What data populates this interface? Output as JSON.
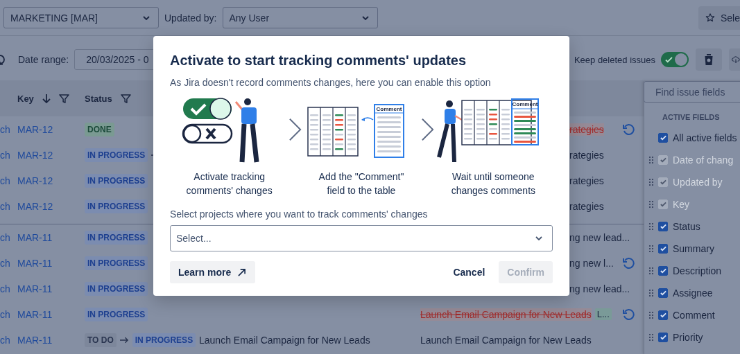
{
  "project_select": {
    "value": "MARKETING [MAR]"
  },
  "updated_by": {
    "label": "Updated by:",
    "value": "Any User"
  },
  "favorites_button": {
    "label": "Sele"
  },
  "date_range": {
    "label": "Date range:",
    "value": "20/03/2025 - 0"
  },
  "keep_deleted": {
    "label": "Keep deleted issues",
    "on": true
  },
  "table": {
    "columns": [
      {
        "label": "Key",
        "sorted": true
      },
      {
        "label": "Status",
        "sorted": false
      }
    ],
    "groups": [
      {
        "rows": [
          {
            "kind": "clipped",
            "column_1": "ch",
            "key": "MAR-12",
            "statuses": [
              {
                "label": "DONE",
                "kind": "done"
              }
            ],
            "trailing_arrow": false,
            "description": "rategies",
            "removed": true,
            "undo": true
          },
          {
            "kind": "clipped",
            "column_1": "ch",
            "key": "MAR-12",
            "statuses": [
              {
                "label": "IN PROGRESS",
                "kind": "progress"
              }
            ],
            "trailing_arrow": true,
            "description": "rategies",
            "removed": false,
            "undo": false
          },
          {
            "kind": "clipped",
            "column_1": "ch",
            "key": "MAR-12",
            "statuses": [
              {
                "label": "IN PROGRESS",
                "kind": "progress"
              }
            ],
            "trailing_arrow": false,
            "description": "rategies",
            "removed": false,
            "undo": false
          },
          {
            "kind": "clipped",
            "column_1": "ch",
            "key": "MAR-12",
            "statuses": [
              {
                "label": "IN PROGRESS",
                "kind": "progress"
              }
            ],
            "trailing_arrow": false,
            "description": "rategies",
            "removed": false,
            "undo": false
          }
        ]
      },
      {
        "rows": [
          {
            "kind": "clipped",
            "column_1": "ch",
            "key": "MAR-11",
            "statuses": [
              {
                "label": "IN PROGRESS",
                "kind": "progress"
              }
            ],
            "trailing_arrow": false,
            "description": "ng new lead...",
            "removed": false,
            "undo": false
          },
          {
            "kind": "clipped",
            "column_1": "ch",
            "key": "MAR-11",
            "statuses": [
              {
                "label": "IN PROGRESS",
                "kind": "progress"
              }
            ],
            "trailing_arrow": false,
            "description": "ng new l...",
            "removed": false,
            "undo": true
          },
          {
            "kind": "clipped",
            "column_1": "ch",
            "key": "MAR-11",
            "statuses": [
              {
                "label": "IN PROGRESS",
                "kind": "progress"
              }
            ],
            "trailing_arrow": false,
            "description": "ng new lead...",
            "removed": false,
            "undo": false
          },
          {
            "kind": "full",
            "column_1": "ch",
            "key": "MAR-11",
            "statuses": [
              {
                "label": "IN PROGRESS",
                "kind": "progress"
              }
            ],
            "trailing_arrow": false,
            "description": "Launch Email Campaign for New Leads",
            "removed": true,
            "tag": "L...",
            "undo": true
          },
          {
            "kind": "full",
            "column_1": "ch",
            "key": "MAR-11",
            "statuses": [
              {
                "label": "TO DO",
                "kind": "todo"
              },
              {
                "label": "IN PROGRESS",
                "kind": "progress"
              }
            ],
            "trailing_arrow": false,
            "summary": "Launch Email Campaign for New Leads",
            "description": "Launch Email Campaign for New Leads",
            "removed": false,
            "undo": false
          }
        ]
      }
    ]
  },
  "field_picker": {
    "placeholder": "Find issue fields",
    "section": "ACTIVE FIELDS",
    "fields": [
      {
        "label": "All active fields",
        "checked": true,
        "disabled": false,
        "draggable": false
      },
      {
        "label": "Date of chang",
        "checked": true,
        "disabled": true,
        "draggable": true
      },
      {
        "label": "Updated by",
        "checked": true,
        "disabled": true,
        "draggable": true
      },
      {
        "label": "Key",
        "checked": true,
        "disabled": true,
        "draggable": true
      },
      {
        "label": "Status",
        "checked": true,
        "disabled": false,
        "draggable": true
      },
      {
        "label": "Summary",
        "checked": true,
        "disabled": false,
        "draggable": true
      },
      {
        "label": "Description",
        "checked": true,
        "disabled": false,
        "draggable": true
      },
      {
        "label": "Assignee",
        "checked": true,
        "disabled": false,
        "draggable": true
      },
      {
        "label": "Comment",
        "checked": true,
        "disabled": false,
        "draggable": true
      },
      {
        "label": "Priority",
        "checked": true,
        "disabled": false,
        "draggable": true
      }
    ]
  },
  "modal": {
    "title": "Activate to start tracking comments' updates",
    "subtitle": "As Jira doesn't record comments changes, here you can enable this option",
    "steps": [
      {
        "kind": "toggles",
        "caption": "Activate tracking comments' changes"
      },
      {
        "kind": "add-column",
        "column_label": "Comment",
        "caption": "Add the \"Comment\" field to the table"
      },
      {
        "kind": "wait",
        "column_label": "Comment",
        "caption": "Wait until someone changes comments"
      }
    ],
    "projects_label": "Select projects where you want to track comments' changes",
    "projects_select": {
      "placeholder": "Select..."
    },
    "learn_more": "Learn more",
    "cancel": "Cancel",
    "confirm": {
      "label": "Confirm",
      "disabled": true
    }
  }
}
